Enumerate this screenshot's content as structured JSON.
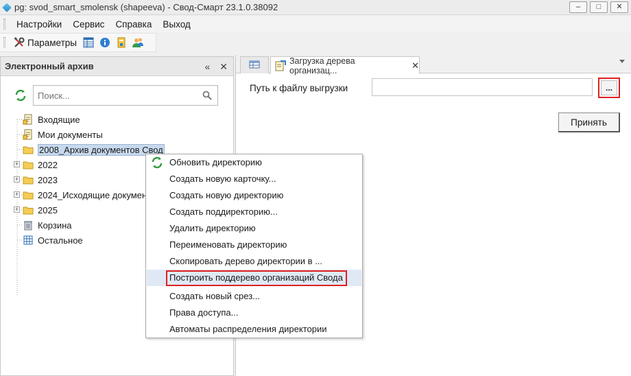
{
  "window": {
    "title": "pg: svod_smart_smolensk (shapeeva) - Свод-Смарт 23.1.0.38092",
    "minimize": "–",
    "maximize": "□",
    "close": "✕"
  },
  "menu": {
    "items": [
      "Настройки",
      "Сервис",
      "Справка",
      "Выход"
    ]
  },
  "toolbar": {
    "params_label": "Параметры"
  },
  "left_panel": {
    "title": "Электронный архив",
    "collapse": "«",
    "close": "✕",
    "search_placeholder": "Поиск..."
  },
  "tree": {
    "items": [
      {
        "label": "Входящие",
        "icon": "document-icon"
      },
      {
        "label": "Мои документы",
        "icon": "document-icon"
      },
      {
        "label": "2008_Архив документов Свод",
        "icon": "folder-icon",
        "selected": true
      },
      {
        "label": "2022",
        "icon": "folder-icon",
        "expandable": true
      },
      {
        "label": "2023",
        "icon": "folder-icon",
        "expandable": true
      },
      {
        "label": "2024_Исходящие документы",
        "icon": "folder-icon",
        "expandable": true
      },
      {
        "label": "2025",
        "icon": "folder-icon",
        "expandable": true
      },
      {
        "label": "Корзина",
        "icon": "trash-icon"
      },
      {
        "label": "Остальное",
        "icon": "grid-icon"
      }
    ]
  },
  "tabs": {
    "items": [
      {
        "label": "",
        "icon": "table-icon"
      },
      {
        "label": "Загрузка дерева организац...",
        "icon": "tree-import-icon",
        "active": true,
        "close": "✕"
      }
    ]
  },
  "form": {
    "path_label": "Путь к файлу выгрузки",
    "path_value": "",
    "browse_label": "...",
    "accept_label": "Принять"
  },
  "context_menu": {
    "items": [
      {
        "label": "Обновить директорию",
        "icon": "refresh-icon"
      },
      {
        "label": "Создать новую карточку..."
      },
      {
        "label": "Создать новую директорию"
      },
      {
        "label": "Создать поддиректорию..."
      },
      {
        "label": "Удалить директорию"
      },
      {
        "label": "Переименовать директорию"
      },
      {
        "label": "Скопировать дерево директории в ..."
      },
      {
        "label": "Построить поддерево организаций Свода",
        "highlighted": true
      },
      {
        "label": "Создать новый срез..."
      },
      {
        "label": "Права доступа..."
      },
      {
        "label": "Автоматы распределения директории"
      }
    ]
  },
  "colors": {
    "highlight_border": "#e02020",
    "selection": "#c7d9ee"
  }
}
